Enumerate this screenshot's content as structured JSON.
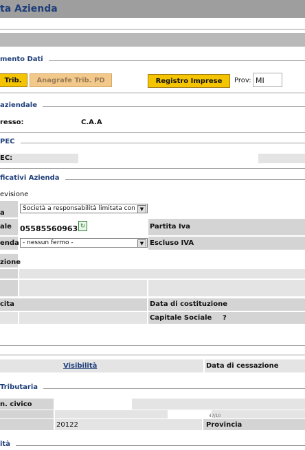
{
  "header": {
    "title": "ta Azienda"
  },
  "sections": {
    "dati": "mento Dati",
    "aziendale": "aziendale",
    "pec": "PEC",
    "identificativi": "ficativi Azienda",
    "tributaria": "Tributaria",
    "last": "ità"
  },
  "toolbar": {
    "trib_label": "Trib.",
    "anagrafe_label": "Anagrafe Trib. PD",
    "registro_label": "Registro Imprese",
    "prov_label": "Prov:",
    "prov_value": "MI"
  },
  "aziendale": {
    "indirizzo_label": "resso:",
    "indirizzo_value": "C.A.A"
  },
  "pec": {
    "label": "EC:"
  },
  "identificativi": {
    "revisione": "evisione",
    "forma_label": "a",
    "forma_value": "Società a responsabilità limitata con s",
    "cf_label": "ale",
    "cf_value": "05585560963",
    "piva_label": "Partita Iva",
    "fermo_label": "enda",
    "fermo_value": "- nessun fermo -",
    "escluso_label": "Escluso IVA",
    "zione_label": "zione",
    "cita_label": "cita",
    "costituzione_label": "Data di costituzione",
    "capitale_label": "Capitale Sociale",
    "capitale_q": "?"
  },
  "visibilita": {
    "link": "Visibilità",
    "cessazione": "Data di cessazione"
  },
  "tributaria": {
    "civico_label": "n. civico",
    "cap_value": "20122",
    "provincia_label": "Provincia",
    "partial_text": "47/10"
  },
  "colors": {
    "accent": "#f5c400",
    "title_blue": "#1f3f7a",
    "bar_grey": "#9e9e9e"
  }
}
